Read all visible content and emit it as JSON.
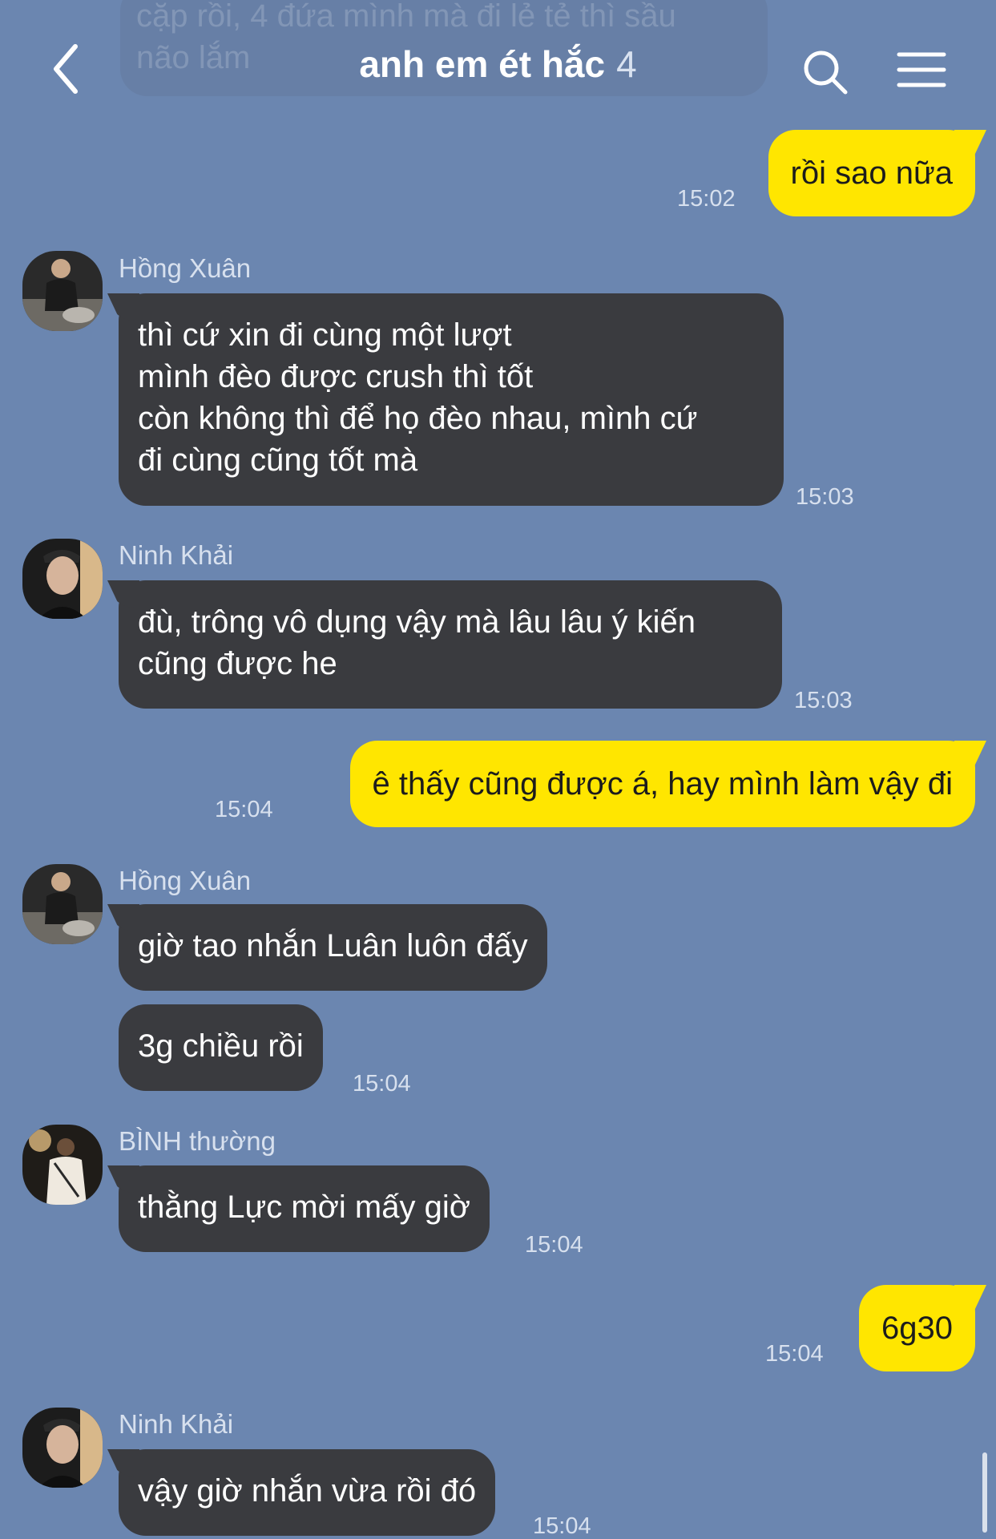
{
  "header": {
    "title": "anh em ét hắc",
    "member_count": "4",
    "prev_message_fragment": "cặp  rồi, 4 đứa mình mà đi lẻ tẻ thì sầu\nnão lắm"
  },
  "messages": [
    {
      "id": "m1",
      "direction": "out",
      "text": "rồi sao nữa",
      "time": "15:02"
    },
    {
      "id": "m2",
      "direction": "in",
      "sender": "Hồng Xuân",
      "avatar_icon": "avatar-hong-xuan",
      "text": "thì cứ xin đi cùng một lượt\nmình đèo được crush thì tốt\ncòn không thì để họ đèo nhau, mình cứ\nđi cùng cũng tốt mà",
      "time": "15:03"
    },
    {
      "id": "m3",
      "direction": "in",
      "sender": "Ninh Khải",
      "avatar_icon": "avatar-ninh-khai",
      "text": "đù, trông vô dụng vậy mà lâu lâu ý kiến\ncũng được he",
      "time": "15:03"
    },
    {
      "id": "m4",
      "direction": "out",
      "text": "ê thấy cũng được á, hay mình làm vậy đi",
      "time": "15:04"
    },
    {
      "id": "m5",
      "direction": "in",
      "sender": "Hồng Xuân",
      "avatar_icon": "avatar-hong-xuan",
      "text": "giờ tao nhắn Luân luôn đấy"
    },
    {
      "id": "m6",
      "direction": "in",
      "text": "3g chiều rồi",
      "time": "15:04"
    },
    {
      "id": "m7",
      "direction": "in",
      "sender": "BÌNH thường",
      "avatar_icon": "avatar-binh-thuong",
      "text": "thằng Lực mời mấy giờ",
      "time": "15:04"
    },
    {
      "id": "m8",
      "direction": "out",
      "text": "6g30",
      "time": "15:04"
    },
    {
      "id": "m9",
      "direction": "in",
      "sender": "Ninh Khải",
      "avatar_icon": "avatar-ninh-khai",
      "text": "vậy giờ nhắn vừa rồi đó",
      "time": "15:04"
    }
  ],
  "colors": {
    "background": "#6b86b0",
    "incoming_bubble": "#3a3b3f",
    "outgoing_bubble": "#ffe600"
  },
  "icons": {
    "back": "chevron-left-icon",
    "search": "search-icon",
    "menu": "menu-icon"
  }
}
